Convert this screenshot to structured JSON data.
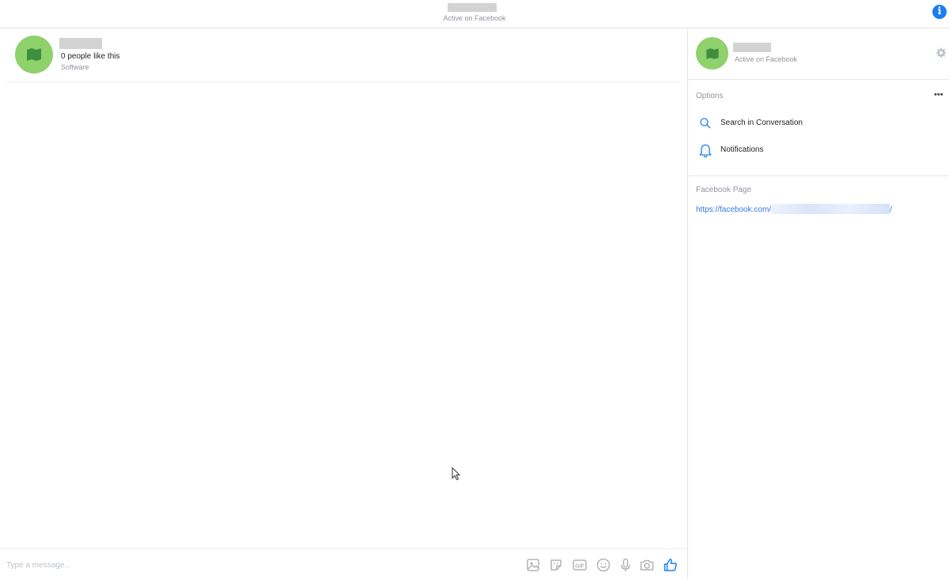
{
  "topbar": {
    "status": "Active on Facebook",
    "info_icon": "info-icon",
    "accent_color": "#1a7ef2"
  },
  "conversation": {
    "header": {
      "likes": "0 people like this",
      "category": "Software",
      "avatar_icon": "flag-icon",
      "avatar_color": "#8fd16a"
    },
    "composer": {
      "placeholder": "Type a message...",
      "tools": [
        "image-icon",
        "sticker-icon",
        "gif-icon",
        "emoji-icon",
        "microphone-icon",
        "camera-icon",
        "like-icon"
      ],
      "gif_label": "GIF"
    }
  },
  "details": {
    "status": "Active on Facebook",
    "options": {
      "title": "Options",
      "more_label": "•••",
      "items": [
        {
          "label": "Search in Conversation",
          "icon": "search-icon"
        },
        {
          "label": "Notifications",
          "icon": "bell-icon"
        }
      ]
    },
    "facebook_page": {
      "title": "Facebook Page",
      "link_prefix": "https://facebook.com/",
      "link_suffix": "/"
    }
  }
}
